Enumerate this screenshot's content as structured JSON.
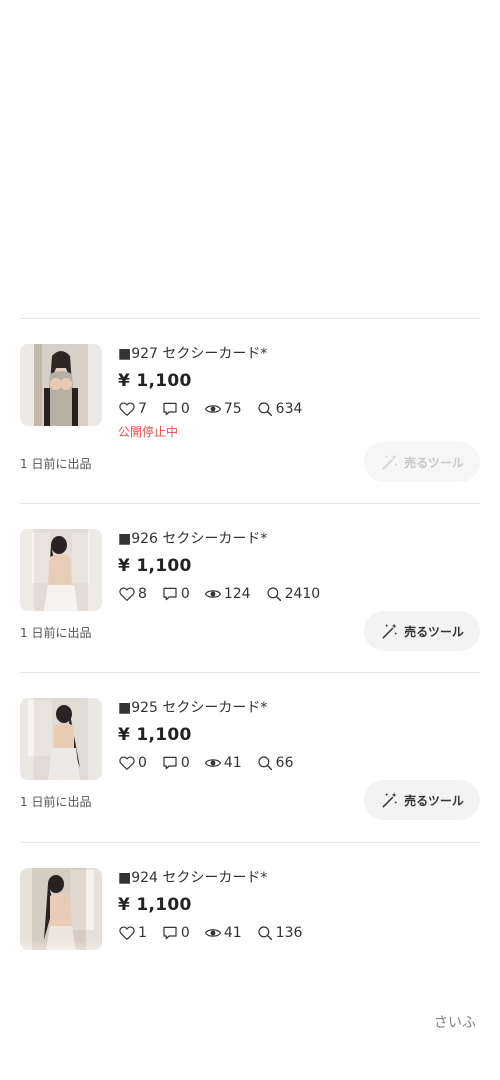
{
  "listings": [
    {
      "title": "■927 セクシーカード*",
      "price": "¥ 1,100",
      "likes": "7",
      "comments": "0",
      "views": "75",
      "searches": "634",
      "status": "公開停止中",
      "listed": "1 日前に出品",
      "sell_label": "売るツール",
      "sell_enabled": false
    },
    {
      "title": "■926 セクシーカード*",
      "price": "¥ 1,100",
      "likes": "8",
      "comments": "0",
      "views": "124",
      "searches": "2410",
      "listed": "1 日前に出品",
      "sell_label": "売るツール",
      "sell_enabled": true
    },
    {
      "title": "■925 セクシーカード*",
      "price": "¥ 1,100",
      "likes": "0",
      "comments": "0",
      "views": "41",
      "searches": "66",
      "listed": "1 日前に出品",
      "sell_label": "売るツール",
      "sell_enabled": true
    },
    {
      "title": "■924 セクシーカード*",
      "price": "¥ 1,100",
      "likes": "1",
      "comments": "0",
      "views": "41",
      "searches": "136"
    }
  ],
  "footer": {
    "corner_text": "さいふ"
  },
  "colors": {
    "status_red": "#e0504a",
    "button_bg": "#f3f3f3",
    "divider": "#e6e6e6"
  },
  "icons": {
    "like": "heart-icon",
    "comment": "comment-icon",
    "view": "eye-icon",
    "search": "search-icon",
    "sell": "magic-wand-icon"
  }
}
